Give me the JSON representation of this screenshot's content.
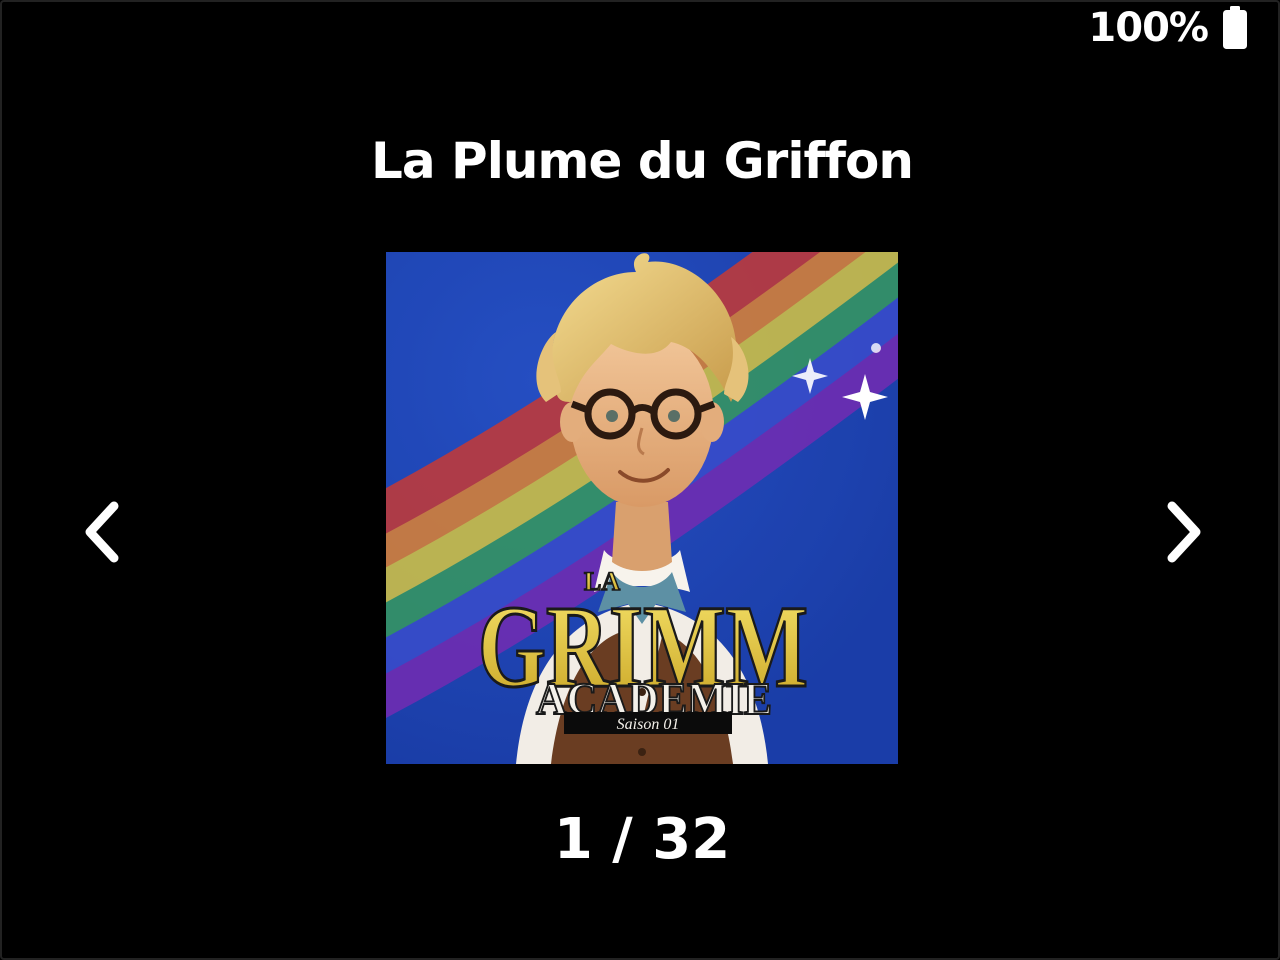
{
  "status_bar": {
    "battery_percent": "100%",
    "battery_icon": "battery-full-icon"
  },
  "title": "La Plume du Griffon",
  "navigation": {
    "prev_icon": "chevron-left-icon",
    "next_icon": "chevron-right-icon"
  },
  "cover": {
    "logo_la": "LA",
    "logo_grimm": "GRIMM",
    "logo_academie": "ACADEMIE",
    "logo_saison": "Saison 01"
  },
  "pagination": {
    "current": 1,
    "total": 32,
    "label": "1 / 32"
  },
  "colors": {
    "background": "#000000",
    "text": "#ffffff",
    "cover_background": "#1f47b8",
    "logo_gold": "#e9cf3a"
  }
}
